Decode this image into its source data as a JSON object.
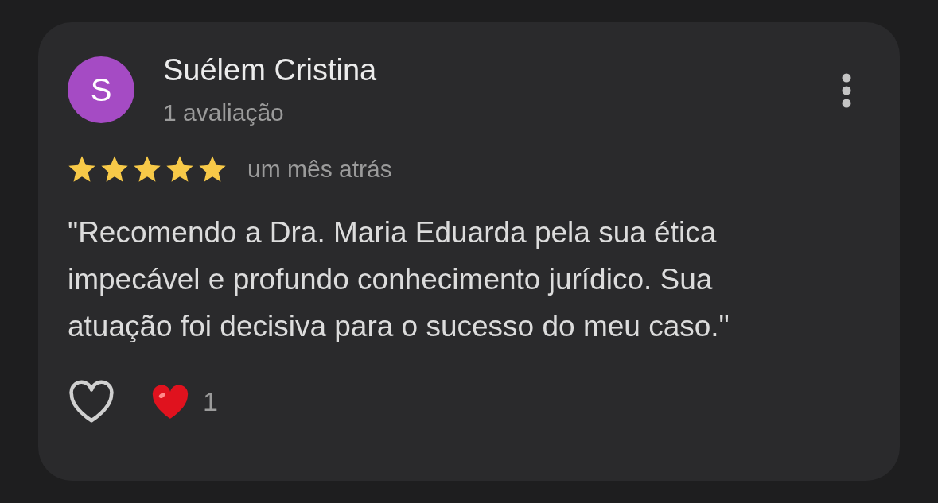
{
  "review": {
    "author": {
      "initial": "S",
      "name": "Suélem Cristina",
      "reviews": "1 avaliação",
      "color": "#a54bc4"
    },
    "stars": 5,
    "time": "um mês atrás",
    "text": "\"Recomendo a Dra. Maria Eduarda pela sua ética impecável e profundo conhecimento jurídico. Sua atuação foi decisiva para o sucesso do meu caso.\"",
    "liked": false,
    "reaction_count": "1"
  }
}
